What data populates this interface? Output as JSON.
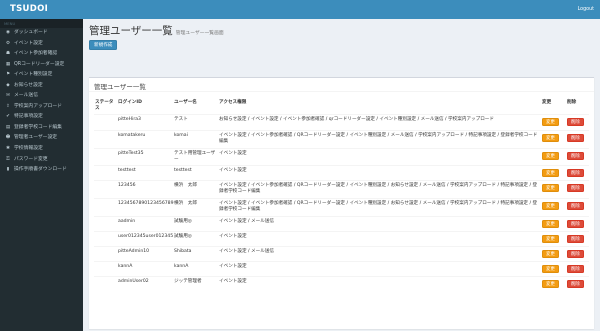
{
  "header": {
    "brand": "TSUDOI",
    "logout": "Logout"
  },
  "sidebar": {
    "header": "MENU",
    "items": [
      {
        "label": "ダッシュボード",
        "icon": "dashboard-icon",
        "glyph": "◉"
      },
      {
        "label": "イベント設定",
        "icon": "gear-icon",
        "glyph": "⚙"
      },
      {
        "label": "イベント参加者確認",
        "icon": "users-icon",
        "glyph": "☗"
      },
      {
        "label": "QRコードリーダー設定",
        "icon": "qrcode-icon",
        "glyph": "▦"
      },
      {
        "label": "イベント種別設定",
        "icon": "flag-icon",
        "glyph": "⚑"
      },
      {
        "label": "お知らせ設定",
        "icon": "bell-icon",
        "glyph": "◆"
      },
      {
        "label": "メール送信",
        "icon": "envelope-icon",
        "glyph": "✉"
      },
      {
        "label": "学校案内アップロード",
        "icon": "upload-icon",
        "glyph": "⇪"
      },
      {
        "label": "特記事項設定",
        "icon": "check-icon",
        "glyph": "✔"
      },
      {
        "label": "登録者学校コード編集",
        "icon": "table-icon",
        "glyph": "▤"
      },
      {
        "label": "管理者ユーザー設定",
        "icon": "user-icon",
        "glyph": "☻"
      },
      {
        "label": "学校情報設定",
        "icon": "settings-icon",
        "glyph": "✱"
      },
      {
        "label": "パスワード変更",
        "icon": "key-icon",
        "glyph": "⚿"
      },
      {
        "label": "操作手順書ダウンロード",
        "icon": "book-icon",
        "glyph": "▮"
      }
    ]
  },
  "page": {
    "title": "管理ユーザー一覧",
    "subtitle": "管理ユーザー一覧画面",
    "new_button": "新規作成"
  },
  "box": {
    "title": "管理ユーザー一覧"
  },
  "table": {
    "columns": {
      "status": "ステータス",
      "login_id": "ログインID",
      "username": "ユーザー名",
      "access": "アクセス権限",
      "edit": "変更",
      "delete": "削除"
    },
    "edit_label": "変更",
    "delete_label": "削除",
    "rows": [
      {
        "login_id": "pitteHira3",
        "username": "テスト",
        "access": "お知らせ設定 / イベント設定 / イベント参加者確認 / qrコードリーダー設定 / イベント種別設定 / メール送信 / 学校案内アップロード"
      },
      {
        "login_id": "komatakeru",
        "username": "komai",
        "access": "イベント設定 / イベント参加者確認 / QRコードリーダー設定 / イベント種別設定 / メール送信 / 学校案内アップロード / 特記事項設定 / 登録者学校コード編集"
      },
      {
        "login_id": "pitteTest35",
        "username": "テスト用管理ユーザー",
        "access": "イベント設定"
      },
      {
        "login_id": "testtest",
        "username": "testtest",
        "access": "イベント設定"
      },
      {
        "login_id": "123456",
        "username": "横浜　太郎",
        "access": "イベント設定 / イベント参加者確認 / QRコードリーダー設定 / イベント種別設定 / お知らせ設定 / メール送信 / 学校案内アップロード / 特記事項設定 / 登録者学校コード編集"
      },
      {
        "login_id": "1234567890123456789",
        "username": "横浜　太郎",
        "access": "イベント設定 / イベント参加者確認 / QRコードリーダー設定 / イベント種別設定 / お知らせ設定 / メール送信 / 学校案内アップロード / 特記事項設定 / 登録者学校コード編集"
      },
      {
        "login_id": "aadmin",
        "username": "試験用◎",
        "access": "イベント設定 / メール送信"
      },
      {
        "login_id": "user012345user012345",
        "username": "試験用◎",
        "access": "イベント設定"
      },
      {
        "login_id": "pitteAdmin10",
        "username": "Shibata",
        "access": "イベント設定 / メール送信"
      },
      {
        "login_id": "kannA",
        "username": "kannA",
        "access": "イベント設定"
      },
      {
        "login_id": "adminUser02",
        "username": "ジッテ管理者",
        "access": "イベント設定"
      }
    ]
  }
}
